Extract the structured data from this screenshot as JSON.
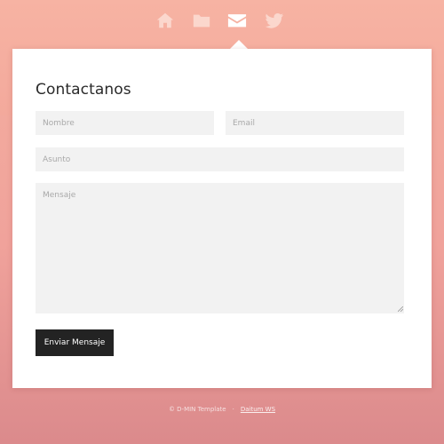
{
  "nav": {
    "items": [
      {
        "icon": "home-icon",
        "active": false
      },
      {
        "icon": "folder-icon",
        "active": false
      },
      {
        "icon": "envelope-icon",
        "active": true
      },
      {
        "icon": "twitter-icon",
        "active": false
      }
    ]
  },
  "form": {
    "title": "Contactanos",
    "fields": {
      "nombre": {
        "placeholder": "Nombre",
        "value": ""
      },
      "email": {
        "placeholder": "Email",
        "value": ""
      },
      "asunto": {
        "placeholder": "Asunto",
        "value": ""
      },
      "mensaje": {
        "placeholder": "Mensaje",
        "value": ""
      }
    },
    "submit_label": "Enviar Mensaje"
  },
  "footer": {
    "copyright": "© D-MIN Template",
    "separator": "·",
    "credit_link": "Daitum WS"
  },
  "colors": {
    "background_top": "#f4b0a0",
    "background_bottom": "#db8a8c",
    "nav_icon_inactive": "#fbd7cd",
    "nav_icon_active": "#ffffff",
    "field_background": "#f2f2f2",
    "button_background": "#232323"
  }
}
